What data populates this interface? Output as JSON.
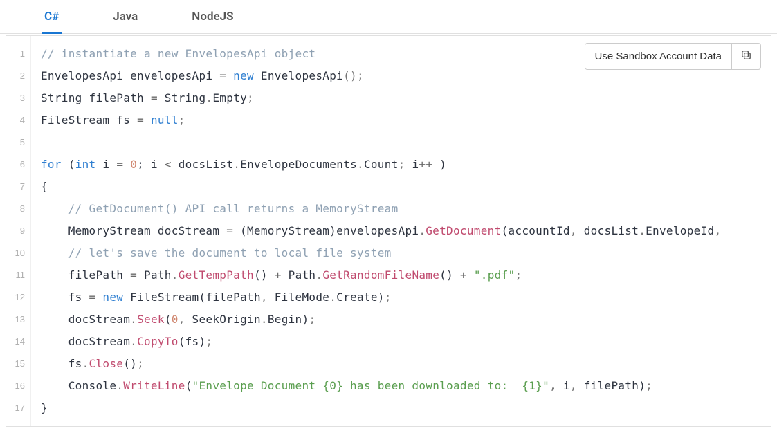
{
  "tabs": {
    "items": [
      {
        "label": "C#",
        "active": true
      },
      {
        "label": "Java",
        "active": false
      },
      {
        "label": "NodeJS",
        "active": false
      }
    ]
  },
  "toolbar": {
    "sandbox_label": "Use Sandbox Account Data",
    "copy_icon": "copy-icon"
  },
  "code": {
    "language": "csharp",
    "lines": [
      {
        "n": 1,
        "tokens": [
          {
            "t": "// instantiate a new EnvelopesApi object",
            "c": "com"
          }
        ]
      },
      {
        "n": 2,
        "tokens": [
          {
            "t": "EnvelopesApi envelopesApi "
          },
          {
            "t": "=",
            "c": "op"
          },
          {
            "t": " "
          },
          {
            "t": "new",
            "c": "kw"
          },
          {
            "t": " EnvelopesApi"
          },
          {
            "t": "();",
            "c": "pun"
          }
        ]
      },
      {
        "n": 3,
        "tokens": [
          {
            "t": "String filePath "
          },
          {
            "t": "=",
            "c": "op"
          },
          {
            "t": " String"
          },
          {
            "t": ".",
            "c": "pun"
          },
          {
            "t": "Empty"
          },
          {
            "t": ";",
            "c": "pun"
          }
        ]
      },
      {
        "n": 4,
        "tokens": [
          {
            "t": "FileStream fs "
          },
          {
            "t": "=",
            "c": "op"
          },
          {
            "t": " "
          },
          {
            "t": "null",
            "c": "kw"
          },
          {
            "t": ";",
            "c": "pun"
          }
        ]
      },
      {
        "n": 5,
        "tokens": [
          {
            "t": ""
          }
        ]
      },
      {
        "n": 6,
        "tokens": [
          {
            "t": "for",
            "c": "kw"
          },
          {
            "t": " ("
          },
          {
            "t": "int",
            "c": "kw"
          },
          {
            "t": " i "
          },
          {
            "t": "=",
            "c": "op"
          },
          {
            "t": " "
          },
          {
            "t": "0",
            "c": "num"
          },
          {
            "t": "; i "
          },
          {
            "t": "<",
            "c": "op"
          },
          {
            "t": " docsList"
          },
          {
            "t": ".",
            "c": "pun"
          },
          {
            "t": "EnvelopeDocuments"
          },
          {
            "t": ".",
            "c": "pun"
          },
          {
            "t": "Count"
          },
          {
            "t": ";",
            "c": "pun"
          },
          {
            "t": " i"
          },
          {
            "t": "++",
            "c": "op"
          },
          {
            "t": " )"
          }
        ]
      },
      {
        "n": 7,
        "tokens": [
          {
            "t": "{"
          }
        ]
      },
      {
        "n": 8,
        "tokens": [
          {
            "t": "    "
          },
          {
            "t": "// GetDocument() API call returns a MemoryStream",
            "c": "com"
          }
        ]
      },
      {
        "n": 9,
        "tokens": [
          {
            "t": "    MemoryStream docStream "
          },
          {
            "t": "=",
            "c": "op"
          },
          {
            "t": " (MemoryStream)envelopesApi"
          },
          {
            "t": ".",
            "c": "pun"
          },
          {
            "t": "GetDocument",
            "c": "fn"
          },
          {
            "t": "(accountId"
          },
          {
            "t": ",",
            "c": "pun"
          },
          {
            "t": " docsList"
          },
          {
            "t": ".",
            "c": "pun"
          },
          {
            "t": "EnvelopeId"
          },
          {
            "t": ",",
            "c": "pun"
          },
          {
            "t": " "
          }
        ]
      },
      {
        "n": 10,
        "tokens": [
          {
            "t": "    "
          },
          {
            "t": "// let's save the document to local file system",
            "c": "com"
          }
        ]
      },
      {
        "n": 11,
        "tokens": [
          {
            "t": "    filePath "
          },
          {
            "t": "=",
            "c": "op"
          },
          {
            "t": " Path"
          },
          {
            "t": ".",
            "c": "pun"
          },
          {
            "t": "GetTempPath",
            "c": "fn"
          },
          {
            "t": "() "
          },
          {
            "t": "+",
            "c": "op"
          },
          {
            "t": " Path"
          },
          {
            "t": ".",
            "c": "pun"
          },
          {
            "t": "GetRandomFileName",
            "c": "fn"
          },
          {
            "t": "() "
          },
          {
            "t": "+",
            "c": "op"
          },
          {
            "t": " "
          },
          {
            "t": "\".pdf\"",
            "c": "str"
          },
          {
            "t": ";",
            "c": "pun"
          }
        ]
      },
      {
        "n": 12,
        "tokens": [
          {
            "t": "    fs "
          },
          {
            "t": "=",
            "c": "op"
          },
          {
            "t": " "
          },
          {
            "t": "new",
            "c": "kw"
          },
          {
            "t": " FileStream(filePath"
          },
          {
            "t": ",",
            "c": "pun"
          },
          {
            "t": " FileMode"
          },
          {
            "t": ".",
            "c": "pun"
          },
          {
            "t": "Create)"
          },
          {
            "t": ";",
            "c": "pun"
          }
        ]
      },
      {
        "n": 13,
        "tokens": [
          {
            "t": "    docStream"
          },
          {
            "t": ".",
            "c": "pun"
          },
          {
            "t": "Seek",
            "c": "fn"
          },
          {
            "t": "("
          },
          {
            "t": "0",
            "c": "num"
          },
          {
            "t": ",",
            "c": "pun"
          },
          {
            "t": " SeekOrigin"
          },
          {
            "t": ".",
            "c": "pun"
          },
          {
            "t": "Begin)"
          },
          {
            "t": ";",
            "c": "pun"
          }
        ]
      },
      {
        "n": 14,
        "tokens": [
          {
            "t": "    docStream"
          },
          {
            "t": ".",
            "c": "pun"
          },
          {
            "t": "CopyTo",
            "c": "fn"
          },
          {
            "t": "(fs)"
          },
          {
            "t": ";",
            "c": "pun"
          }
        ]
      },
      {
        "n": 15,
        "tokens": [
          {
            "t": "    fs"
          },
          {
            "t": ".",
            "c": "pun"
          },
          {
            "t": "Close",
            "c": "fn"
          },
          {
            "t": "()"
          },
          {
            "t": ";",
            "c": "pun"
          }
        ]
      },
      {
        "n": 16,
        "tokens": [
          {
            "t": "    Console"
          },
          {
            "t": ".",
            "c": "pun"
          },
          {
            "t": "WriteLine",
            "c": "fn"
          },
          {
            "t": "("
          },
          {
            "t": "\"Envelope Document {0} has been downloaded to:  {1}\"",
            "c": "str"
          },
          {
            "t": ",",
            "c": "pun"
          },
          {
            "t": " i"
          },
          {
            "t": ",",
            "c": "pun"
          },
          {
            "t": " filePath)"
          },
          {
            "t": ";",
            "c": "pun"
          }
        ]
      },
      {
        "n": 17,
        "tokens": [
          {
            "t": "}"
          }
        ]
      }
    ]
  }
}
